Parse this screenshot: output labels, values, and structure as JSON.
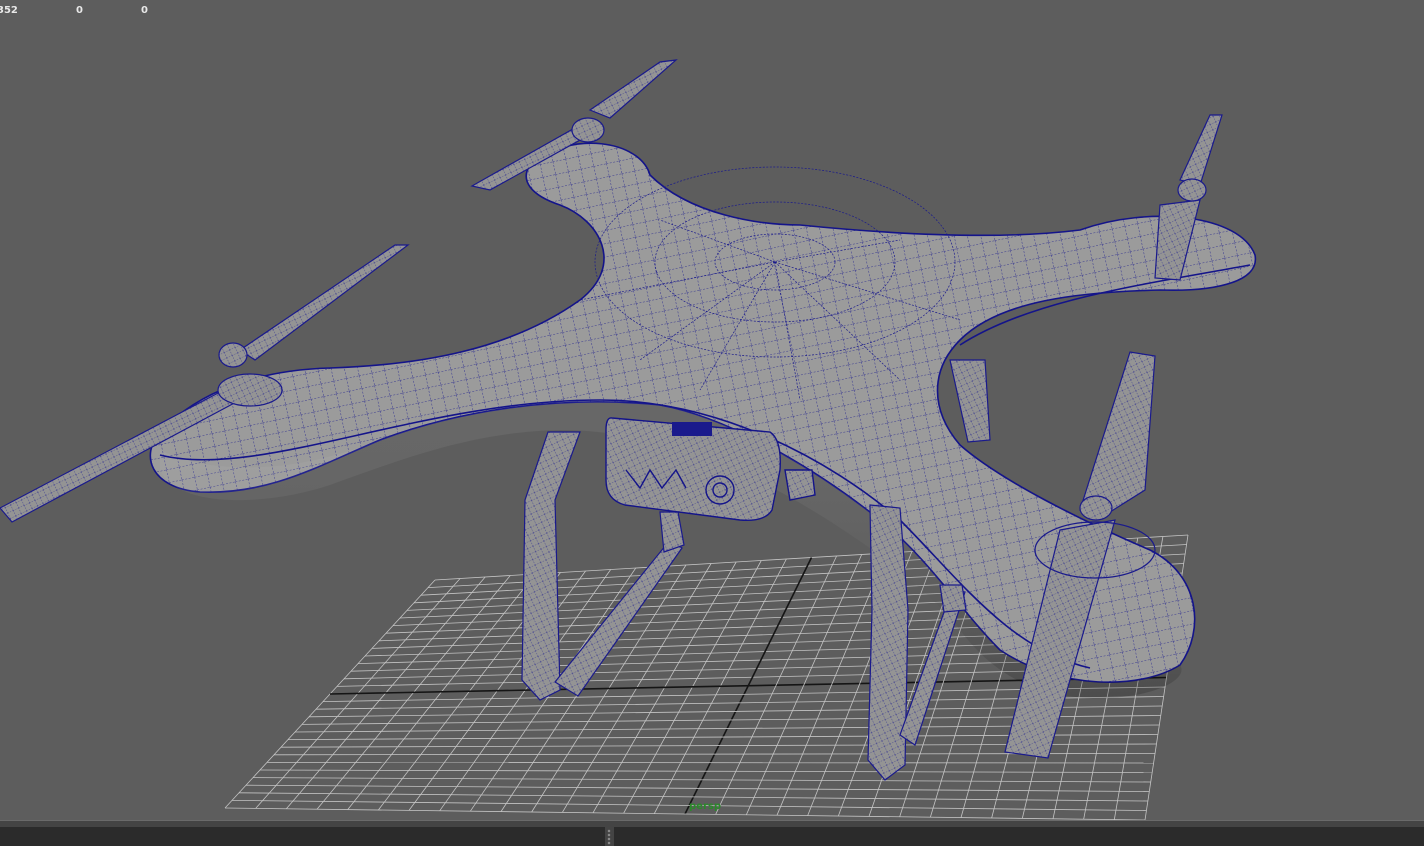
{
  "hud": {
    "values": [
      "352",
      "0",
      "0"
    ]
  },
  "viewport": {
    "camera_label": "persp"
  },
  "colors": {
    "viewport_bg": "#5d5d5d",
    "grid_line": "#c4c4c4",
    "grid_axis": "#151515",
    "mesh_fill": "#9a9a9a",
    "wireframe": "#1a1a8c",
    "camera_label": "#2a8a2a",
    "panel_bg": "#444444",
    "panel_strip": "#2b2b2b"
  },
  "icons": [
    "splitter-handle-icon"
  ]
}
